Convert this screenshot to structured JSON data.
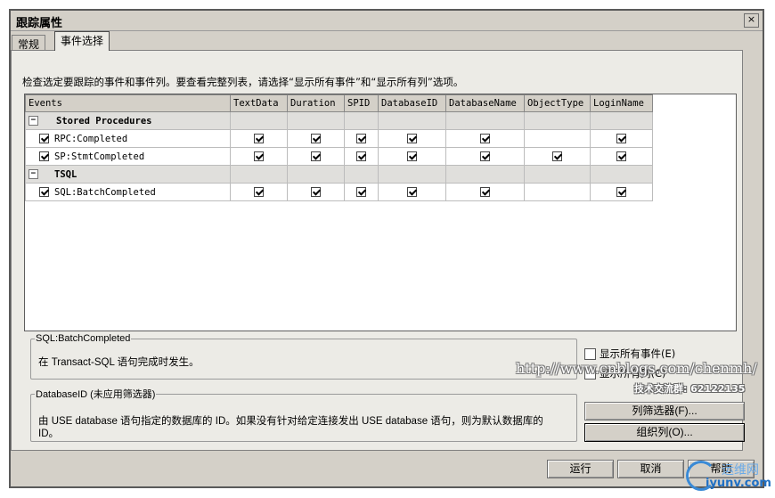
{
  "window": {
    "title": "跟踪属性",
    "close_glyph": "×"
  },
  "tabs": [
    {
      "label": "常规"
    },
    {
      "label": "事件选择"
    }
  ],
  "hint": "检查选定要跟踪的事件和事件列。要查看完整列表，请选择“显示所有事件”和“显示所有列”选项。",
  "grid": {
    "columns": [
      "Events",
      "TextData",
      "Duration",
      "SPID",
      "DatabaseID",
      "DatabaseName",
      "ObjectType",
      "LoginName"
    ],
    "categories": [
      {
        "name": "Stored Procedures",
        "collapse_glyph": "−",
        "events": [
          {
            "name": "RPC:Completed",
            "selected": true,
            "cols": [
              true,
              true,
              true,
              true,
              true,
              false,
              true
            ]
          },
          {
            "name": "SP:StmtCompleted",
            "selected": true,
            "cols": [
              true,
              true,
              true,
              true,
              true,
              true,
              true
            ]
          }
        ]
      },
      {
        "name": "TSQL",
        "collapse_glyph": "−",
        "events": [
          {
            "name": "SQL:BatchCompleted",
            "selected": true,
            "cols": [
              true,
              true,
              true,
              true,
              true,
              false,
              true
            ]
          }
        ]
      }
    ]
  },
  "event_info": {
    "legend": "SQL:BatchCompleted",
    "text": "在 Transact-SQL 语句完成时发生。"
  },
  "column_info": {
    "legend": "DatabaseID (未应用筛选器)",
    "text": "由 USE database 语句指定的数据库的 ID。如果没有针对给定连接发出 USE database 语句，则为默认数据库的 ID。"
  },
  "options": {
    "show_all_events": "显示所有事件(E)",
    "show_all_columns": "显示所有列(C)"
  },
  "buttons": {
    "column_filters": "列筛选器(F)...",
    "organize_columns": "组织列(O)...",
    "run": "运行",
    "cancel": "取消",
    "help": "帮助"
  },
  "watermark": {
    "url": "http://www.cnblogs.com/chenmh/",
    "qq": "技术交流群: 62122135",
    "logo_word": "iyunv.com",
    "logo_cn": "运维网"
  }
}
